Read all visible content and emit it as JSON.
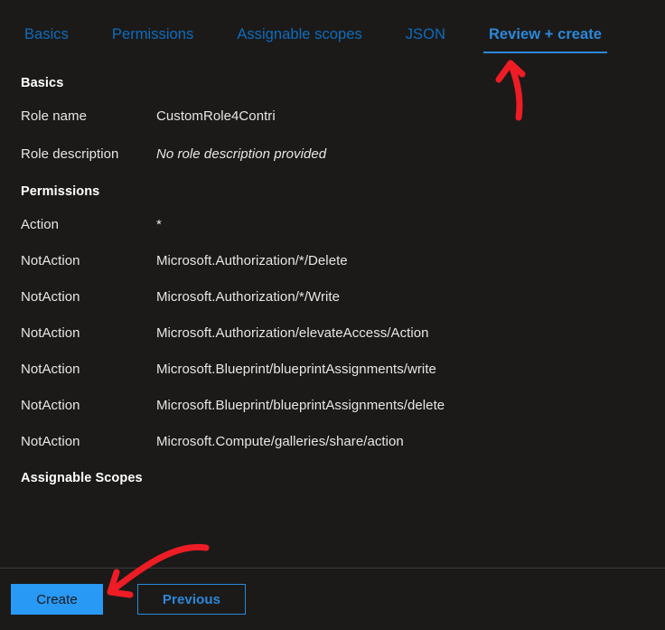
{
  "tabs": [
    {
      "label": "Basics",
      "active": false
    },
    {
      "label": "Permissions",
      "active": false
    },
    {
      "label": "Assignable scopes",
      "active": false
    },
    {
      "label": "JSON",
      "active": false
    },
    {
      "label": "Review + create",
      "active": true
    }
  ],
  "sections": {
    "basics": {
      "heading": "Basics",
      "rows": [
        {
          "label": "Role name",
          "value": "CustomRole4Contri",
          "italic": false
        },
        {
          "label": "Role description",
          "value": "No role description provided",
          "italic": true
        }
      ]
    },
    "permissions": {
      "heading": "Permissions",
      "rows": [
        {
          "label": "Action",
          "value": "*"
        },
        {
          "label": "NotAction",
          "value": "Microsoft.Authorization/*/Delete"
        },
        {
          "label": "NotAction",
          "value": "Microsoft.Authorization/*/Write"
        },
        {
          "label": "NotAction",
          "value": "Microsoft.Authorization/elevateAccess/Action"
        },
        {
          "label": "NotAction",
          "value": "Microsoft.Blueprint/blueprintAssignments/write"
        },
        {
          "label": "NotAction",
          "value": "Microsoft.Blueprint/blueprintAssignments/delete"
        },
        {
          "label": "NotAction",
          "value": "Microsoft.Compute/galleries/share/action"
        }
      ]
    },
    "assignable_scopes": {
      "heading": "Assignable Scopes"
    }
  },
  "footer": {
    "create_label": "Create",
    "previous_label": "Previous"
  },
  "colors": {
    "background": "#1b1a19",
    "tab_link": "#0f6cbd",
    "tab_active": "#2b88d8",
    "primary_button": "#2899f5",
    "annotation": "#ee1c25",
    "divider": "#3b3a39"
  },
  "annotations": [
    {
      "name": "arrow-to-review-create-tab",
      "target": "Review + create"
    },
    {
      "name": "arrow-to-create-button",
      "target": "Create"
    }
  ]
}
